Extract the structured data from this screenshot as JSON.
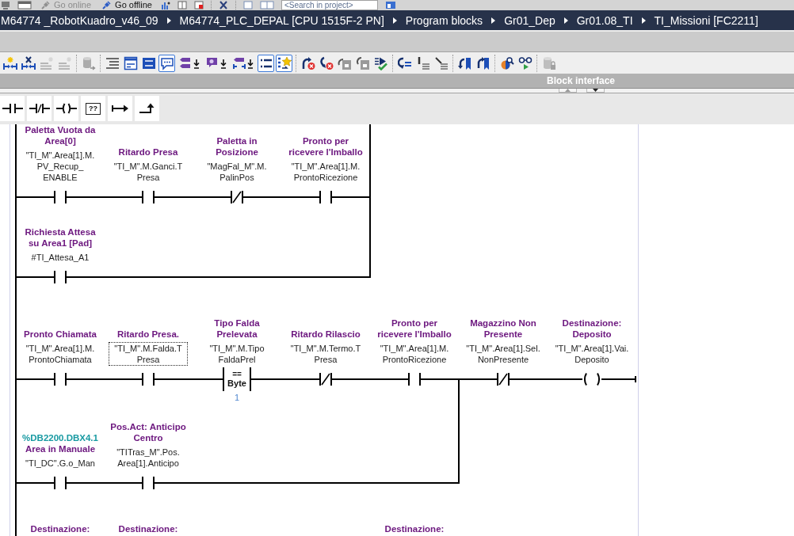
{
  "top_toolbar": {
    "buttons": [
      {
        "label": "Go online",
        "disabled": true
      },
      {
        "label": "Go offline",
        "disabled": false
      }
    ],
    "search": {
      "placeholder": "<Search in project>"
    }
  },
  "breadcrumb": [
    "M64774 _RobotKuadro_v46_09",
    "M64774_PLC_DEPAL [CPU 1515F-2 PN]",
    "Program blocks",
    "Gr01_Dep",
    "Gr01.08_TI",
    "TI_Missioni [FC2211]"
  ],
  "editor_toolbar": {
    "groups": [
      [
        {
          "on": false,
          "disabled": false
        },
        {
          "on": false,
          "disabled": false
        },
        {
          "on": false,
          "disabled": true
        },
        {
          "on": false,
          "disabled": true
        }
      ],
      [
        {
          "on": false,
          "disabled": true
        }
      ],
      [
        {
          "on": false,
          "disabled": false
        },
        {
          "on": false,
          "disabled": false
        },
        {
          "on": false,
          "disabled": false
        },
        {
          "on": true,
          "disabled": false
        },
        {
          "on": false,
          "disabled": false
        },
        {
          "on": false,
          "disabled": false
        },
        {
          "on": false,
          "disabled": false
        },
        {
          "on": true,
          "disabled": false
        },
        {
          "on": true,
          "disabled": false
        }
      ],
      [
        {
          "on": false,
          "disabled": false
        },
        {
          "on": false,
          "disabled": false
        },
        {
          "on": false,
          "disabled": false
        },
        {
          "on": false,
          "disabled": false
        },
        {
          "on": false,
          "disabled": false
        }
      ],
      [
        {
          "on": false,
          "disabled": false
        },
        {
          "on": false,
          "disabled": false
        },
        {
          "on": false,
          "disabled": false
        }
      ],
      [
        {
          "on": false,
          "disabled": false
        },
        {
          "on": false,
          "disabled": false
        }
      ],
      [
        {
          "on": false,
          "disabled": false
        },
        {
          "on": false,
          "disabled": false
        }
      ],
      [
        {
          "on": false,
          "disabled": true
        }
      ]
    ]
  },
  "block_interface": {
    "title": "Block interface"
  },
  "instruction_bar": {
    "buttons": [
      {
        "kind": "no_contact"
      },
      {
        "kind": "nc_contact"
      },
      {
        "kind": "coil"
      },
      {
        "kind": "empty_box",
        "label": "??"
      },
      {
        "kind": "open_branch"
      },
      {
        "kind": "close_branch"
      }
    ]
  },
  "networks": [
    {
      "continued_from_above": true,
      "series": [
        {
          "kind": "parallel",
          "branches": [
            [
              {
                "kind": "no_contact",
                "comment": "Paletta Vuota da\nArea[0]",
                "operand": "\"TI_M\".Area[1].M.\nPV_Recup_\nENABLE",
                "selected": false
              },
              {
                "kind": "no_contact",
                "comment": "Ritardo Presa",
                "operand": "\"TI_M\".M.Ganci.T\nPresa",
                "selected": false
              },
              {
                "kind": "nc_contact",
                "comment": "Paletta in\nPosizione",
                "operand": "\"MagFal_M\".M.\nPalinPos",
                "selected": false
              },
              {
                "kind": "no_contact",
                "comment": "Pronto per\nricevere l'Imballo",
                "operand": "\"TI_M\".Area[1].M.\nProntoRicezione",
                "selected": false
              }
            ],
            [
              {
                "kind": "no_contact",
                "comment": "Richiesta Attesa\nsu Area1 [Pad]",
                "operand": "#TI_Attesa_A1",
                "selected": false
              }
            ]
          ]
        }
      ]
    },
    {
      "continued_from_above": false,
      "series": [
        {
          "kind": "parallel",
          "branches": [
            [
              {
                "kind": "no_contact",
                "comment": "Pronto Chiamata",
                "operand": "\"TI_M\".Area[1].M.\nProntoChiamata",
                "selected": false
              },
              {
                "kind": "no_contact",
                "comment": "Ritardo Presa.",
                "operand": "\"TI_M\".M.Falda.T\nPresa",
                "selected": true
              },
              {
                "kind": "compare",
                "comment": "Tipo Falda\nPrelevata",
                "operand": "\"TI_M\".M.Tipo\nFaldaPrel",
                "operator": "==",
                "data_type": "Byte",
                "value": "1",
                "selected": false
              },
              {
                "kind": "nc_contact",
                "comment": "Ritardo Rilascio",
                "operand": "\"TI_M\".M.Termo.T\nPresa",
                "selected": false
              },
              {
                "kind": "no_contact",
                "comment": "Pronto per\nricevere l'Imballo",
                "operand": "\"TI_M\".Area[1].M.\nProntoRicezione",
                "selected": false
              }
            ],
            [
              {
                "kind": "no_contact",
                "address": "%DB2200.DBX4.1",
                "comment": "Area in Manuale",
                "operand": "\"TI_DC\".G.o_Man",
                "selected": false
              },
              {
                "kind": "no_contact",
                "comment": "Pos.Act: Anticipo\nCentro",
                "operand": "\"TITras_M\".Pos.\nArea[1].Anticipo",
                "selected": false
              }
            ]
          ]
        },
        {
          "kind": "nc_contact",
          "comment": "Magazzino Non\nPresente",
          "operand": "\"TI_M\".Area[1].Sel.\nNonPresente",
          "selected": false
        },
        {
          "kind": "coil",
          "comment": "Destinazione:\nDeposito",
          "operand": "\"TI_M\".Area[1].Vai.\nDeposito",
          "selected": false
        }
      ]
    },
    {
      "series": [
        {
          "kind": "cut_off",
          "comment": "Destinazione:"
        },
        {
          "kind": "cut_off",
          "comment": "Destinazione:"
        },
        {
          "kind": "cut_off"
        },
        {
          "kind": "cut_off"
        },
        {
          "kind": "cut_off",
          "comment": "Destinazione:"
        }
      ]
    }
  ]
}
